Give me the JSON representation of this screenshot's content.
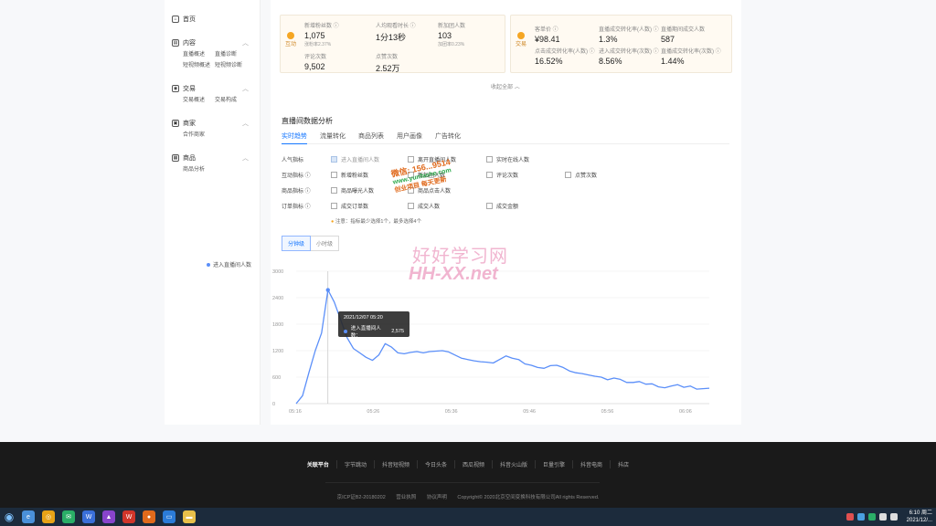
{
  "sidebar": {
    "groups": [
      {
        "label": "首页",
        "icon": "home-icon",
        "items": []
      },
      {
        "label": "内容",
        "icon": "content-icon",
        "items": [
          "直播概述",
          "直播诊断",
          "短视频概述",
          "短视频诊断"
        ]
      },
      {
        "label": "交易",
        "icon": "trade-icon",
        "items": [
          "交易概述",
          "交易构成"
        ]
      },
      {
        "label": "商家",
        "icon": "merchant-icon",
        "items": [
          "合作商家"
        ]
      },
      {
        "label": "商品",
        "icon": "goods-icon",
        "items": [
          "商品分析"
        ]
      }
    ]
  },
  "cards": {
    "left": {
      "label": "互动",
      "metrics": [
        {
          "name": "新增粉丝数",
          "value": "1,075",
          "sub": "涨粉率2.37%"
        },
        {
          "name": "人均观看时长",
          "value": "1分13秒",
          "sub": ""
        },
        {
          "name": "新加团人数",
          "value": "103",
          "sub": "加团率0.23%"
        },
        {
          "name": "评论次数",
          "value": "9,502",
          "sub": ""
        },
        {
          "name": "点赞次数",
          "value": "2.52万",
          "sub": ""
        }
      ]
    },
    "right": {
      "label": "交易",
      "metrics": [
        {
          "name": "客单价",
          "value": "¥98.41"
        },
        {
          "name": "直播成交转化率(人数)",
          "value": "1.3%"
        },
        {
          "name": "直播期间成交人数",
          "value": "587"
        },
        {
          "name": "点击成交转化率(人数)",
          "value": "16.52%"
        },
        {
          "name": "进入成交转化率(次数)",
          "value": "8.56%"
        },
        {
          "name": "直播成交转化率(次数)",
          "value": "1.44%"
        }
      ]
    }
  },
  "collapse_label": "收起全部",
  "section_title": "直播间数据分析",
  "tabs": [
    "实时趋势",
    "流量转化",
    "商品列表",
    "用户画像",
    "广告转化"
  ],
  "filters": {
    "rows": [
      {
        "cat": "人气指标",
        "opts": [
          "进入直播间人数",
          "离开直播间人数",
          "实时在线人数"
        ]
      },
      {
        "cat": "互动指标",
        "opts": [
          "新增粉丝数",
          "新加团人数",
          "评论次数",
          "点赞次数"
        ]
      },
      {
        "cat": "商品指标",
        "opts": [
          "商品曝光人数",
          "商品点击人数"
        ]
      },
      {
        "cat": "订单指标",
        "opts": [
          "成交订单数",
          "成交人数",
          "成交金额"
        ]
      }
    ],
    "note": "注意：指标最少选择1个，最多选择4个"
  },
  "segment": [
    "分钟级",
    "小时级"
  ],
  "chart_data": {
    "type": "line",
    "series": [
      {
        "name": "进入直播间人数",
        "values": [
          0,
          180,
          700,
          1200,
          1600,
          2575,
          2300,
          1900,
          1500,
          1250,
          1150,
          1050,
          980,
          1100,
          1360,
          1280,
          1150,
          1130,
          1160,
          1180,
          1150,
          1180,
          1190,
          1200,
          1170,
          1100,
          1030,
          1000,
          970,
          950,
          940,
          920,
          1000,
          1080,
          1030,
          1000,
          900,
          870,
          820,
          800,
          860,
          870,
          820,
          740,
          700,
          680,
          650,
          620,
          600,
          540,
          580,
          550,
          480,
          480,
          500,
          440,
          450,
          380,
          360,
          400,
          430,
          370,
          400,
          330,
          340,
          350
        ]
      }
    ],
    "x_ticks": [
      "05:16",
      "05:26",
      "05:36",
      "05:46",
      "05:56",
      "06:06"
    ],
    "ylim": [
      0,
      3000
    ],
    "y_ticks": [
      0,
      600,
      1200,
      1800,
      2400,
      3000
    ],
    "grid": true,
    "legend": "top-center",
    "tooltip": {
      "time": "2021/12/07 05:20",
      "label": "进入直播间人数：",
      "value": "2,575"
    }
  },
  "footer": {
    "links": [
      "关联平台",
      "字节跳动",
      "抖音短视频",
      "今日头条",
      "西瓜视频",
      "抖音火山版",
      "巨量引擎",
      "抖音电商",
      "抖店"
    ],
    "copy": [
      "京ICP证B2-20180202",
      "营业执照",
      "协议声明",
      "Copyright© 2020北京空间变换科技有限公司All rights Reserved."
    ]
  },
  "taskbar": {
    "time": "6:10 周二",
    "date": "2021/12/..."
  },
  "watermark": {
    "line1": "好好学习网",
    "line2": "HH-XX.net",
    "stamp": "微信: 156...9514",
    "stamp2": "www.yunfashe.com",
    "stamp3": "创业项目 每天更新"
  },
  "colors": {
    "accent": "#1677ff",
    "line": "#5b8ff9",
    "footer": "#1a1a1a",
    "taskbar": "#1c2b3c"
  }
}
